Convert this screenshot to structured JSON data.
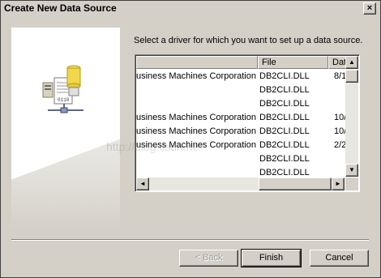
{
  "window": {
    "title": "Create New Data Source",
    "close_glyph": "×"
  },
  "instruction": "Select a driver for which you want to set up a data source.",
  "list": {
    "headers": {
      "name": "",
      "file": "File",
      "date": "Dat"
    },
    "rows": [
      {
        "name": "usiness Machines Corporation",
        "file": "DB2CLI.DLL",
        "date": "8/1"
      },
      {
        "name": "",
        "file": "DB2CLI.DLL",
        "date": ""
      },
      {
        "name": "",
        "file": "DB2CLI.DLL",
        "date": ""
      },
      {
        "name": "usiness Machines Corporation",
        "file": "DB2CLI.DLL",
        "date": "10/"
      },
      {
        "name": "usiness Machines Corporation",
        "file": "DB2CLI.DLL",
        "date": "10/"
      },
      {
        "name": "usiness Machines Corporation",
        "file": "DB2CLI.DLL",
        "date": "2/2"
      },
      {
        "name": "",
        "file": "DB2CLI.DLL",
        "date": ""
      },
      {
        "name": "",
        "file": "DB2CLI.DLL",
        "date": ""
      }
    ],
    "scroll_arrows": {
      "up": "▲",
      "down": "▼",
      "left": "◄",
      "right": "►"
    }
  },
  "buttons": {
    "back": "< Back",
    "finish": "Finish",
    "cancel": "Cancel"
  },
  "watermark": "http://blog.csdn.ne",
  "icons": {
    "wizard_art": "database-driver-icon"
  },
  "colors": {
    "face": "#d4d0c8",
    "list_bg": "#ffffff"
  }
}
